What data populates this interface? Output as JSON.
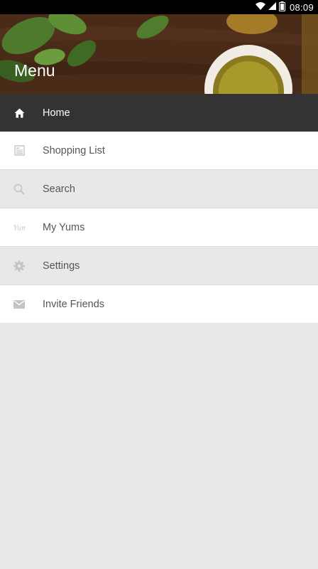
{
  "status_bar": {
    "time": "08:09",
    "icons": [
      "wifi-icon",
      "signal-icon",
      "battery-icon"
    ]
  },
  "header": {
    "title": "Menu"
  },
  "menu": {
    "items": [
      {
        "label": "Home",
        "icon": "home-icon",
        "active": true
      },
      {
        "label": "Shopping List",
        "icon": "list-icon",
        "active": false
      },
      {
        "label": "Search",
        "icon": "search-icon",
        "active": false
      },
      {
        "label": "My Yums",
        "icon": "yums-icon",
        "active": false
      },
      {
        "label": "Settings",
        "icon": "gear-icon",
        "active": false
      },
      {
        "label": "Invite Friends",
        "icon": "mail-icon",
        "active": false
      }
    ]
  },
  "colors": {
    "active_bg": "#333333",
    "row_white": "#ffffff",
    "row_gray": "#e8e8e8",
    "icon_inactive": "#c4c4c4",
    "icon_active": "#ffffff",
    "text_inactive": "#555555"
  }
}
